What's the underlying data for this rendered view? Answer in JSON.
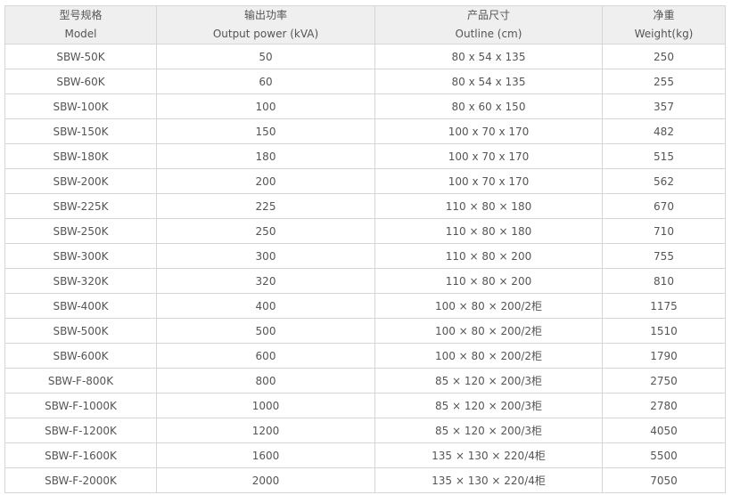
{
  "headers": [
    {
      "zh": "型号规格",
      "en": "Model"
    },
    {
      "zh": "输出功率",
      "en": "Output power (kVA)"
    },
    {
      "zh": "产品尺寸",
      "en": "Outline (cm)"
    },
    {
      "zh": "净重",
      "en": "Weight(kg)"
    }
  ],
  "rows": [
    [
      "SBW-50K",
      "50",
      "80 x 54 x 135",
      "250"
    ],
    [
      "SBW-60K",
      "60",
      "80 x 54 x 135",
      "255"
    ],
    [
      "SBW-100K",
      "100",
      "80 x 60 x 150",
      "357"
    ],
    [
      "SBW-150K",
      "150",
      "100 x 70 x 170",
      "482"
    ],
    [
      "SBW-180K",
      "180",
      "100 x 70 x 170",
      "515"
    ],
    [
      "SBW-200K",
      "200",
      "100 x 70 x 170",
      "562"
    ],
    [
      "SBW-225K",
      "225",
      "110 × 80 × 180",
      "670"
    ],
    [
      "SBW-250K",
      "250",
      "110 × 80 × 180",
      "710"
    ],
    [
      "SBW-300K",
      "300",
      "110 × 80 × 200",
      "755"
    ],
    [
      "SBW-320K",
      "320",
      "110 × 80 × 200",
      "810"
    ],
    [
      "SBW-400K",
      "400",
      "100 × 80 × 200/2柜",
      "1175"
    ],
    [
      "SBW-500K",
      "500",
      "100 × 80 × 200/2柜",
      "1510"
    ],
    [
      "SBW-600K",
      "600",
      "100 × 80 × 200/2柜",
      "1790"
    ],
    [
      "SBW-F-800K",
      "800",
      "85 × 120 × 200/3柜",
      "2750"
    ],
    [
      "SBW-F-1000K",
      "1000",
      "85 × 120 × 200/3柜",
      "2780"
    ],
    [
      "SBW-F-1200K",
      "1200",
      "85 × 120 × 200/3柜",
      "4050"
    ],
    [
      "SBW-F-1600K",
      "1600",
      "135 × 130 × 220/4柜",
      "5500"
    ],
    [
      "SBW-F-2000K",
      "2000",
      "135 × 130 × 220/4柜",
      "7050"
    ]
  ]
}
